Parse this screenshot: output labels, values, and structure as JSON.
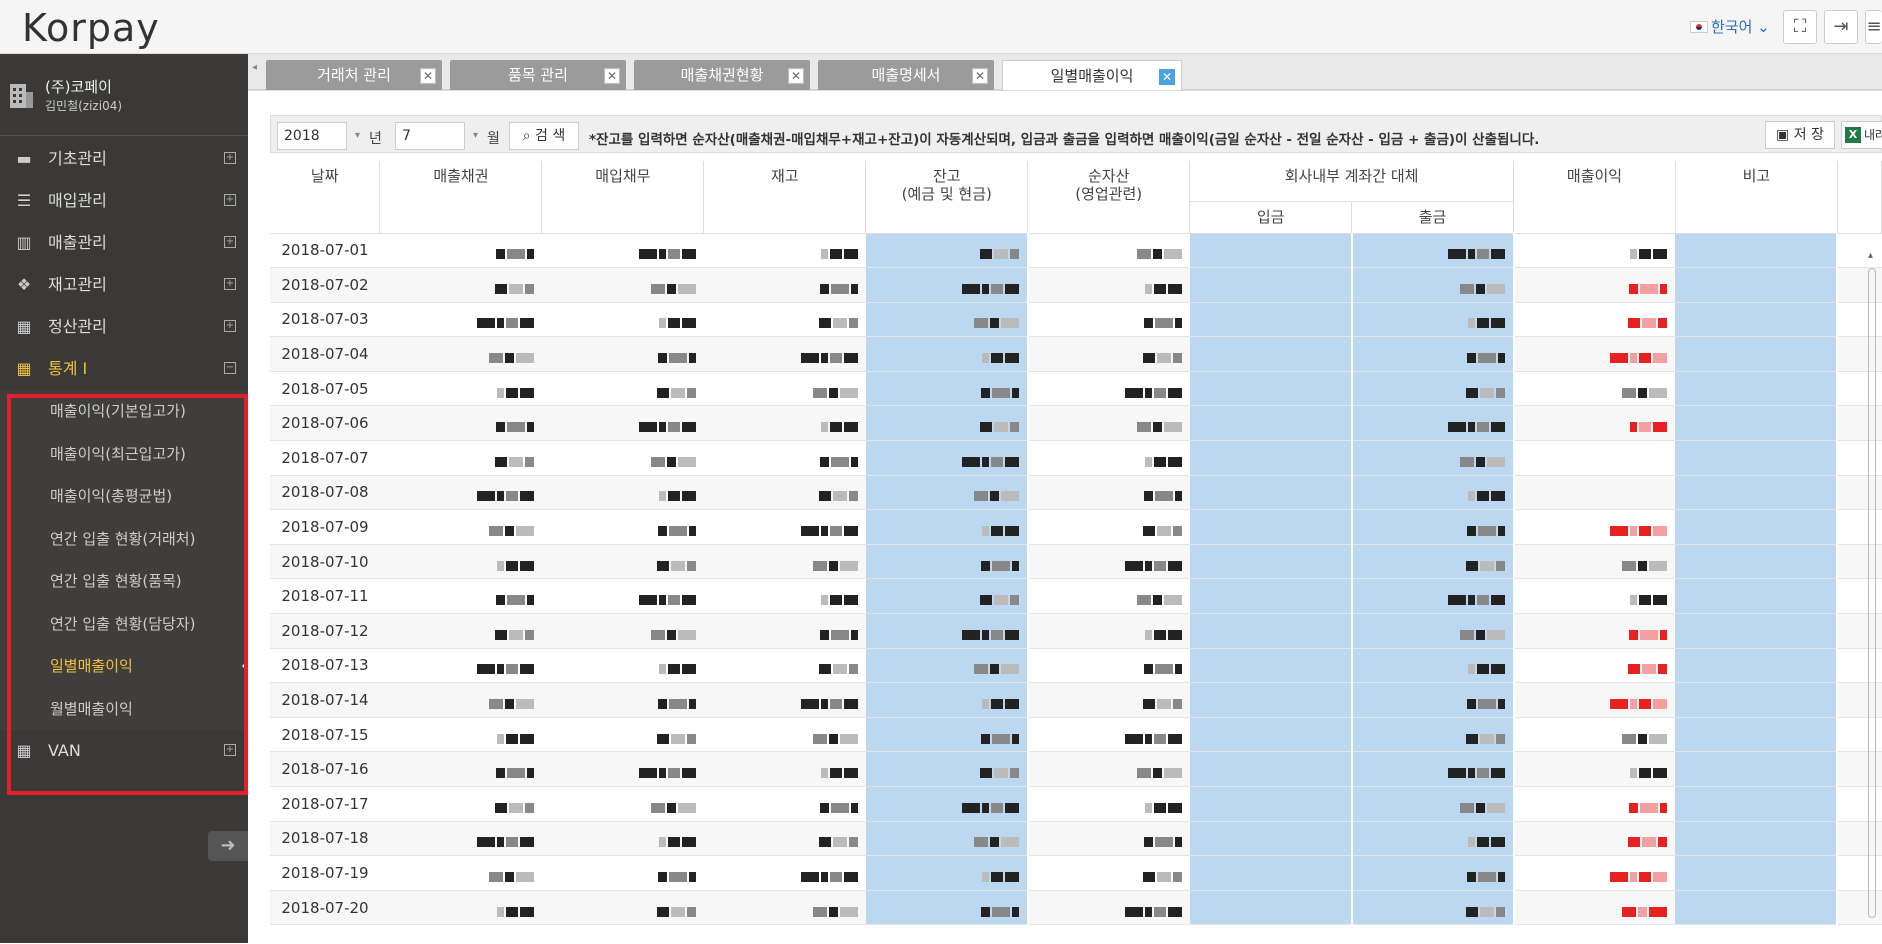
{
  "app": {
    "logo": "Korpay",
    "language": "한국어",
    "header_buttons": [
      "fullscreen-icon",
      "logout-icon",
      "menu-icon"
    ]
  },
  "sidebar": {
    "company_name": "(주)코페이",
    "user": "김민철(zizi04)",
    "menu": [
      {
        "label": "기초관리",
        "icon": "folder-icon"
      },
      {
        "label": "매입관리",
        "icon": "list-icon"
      },
      {
        "label": "매출관리",
        "icon": "bar-chart-icon"
      },
      {
        "label": "재고관리",
        "icon": "boxes-icon"
      },
      {
        "label": "정산관리",
        "icon": "calculator-icon"
      },
      {
        "label": "통계 I",
        "icon": "calculator-icon",
        "expanded": true
      },
      {
        "label": "VAN",
        "icon": "calculator-icon"
      }
    ],
    "submenu": [
      "매출이익(기본입고가)",
      "매출이익(최근입고가)",
      "매출이익(총평균법)",
      "연간 입출 현황(거래처)",
      "연간 입출 현황(품목)",
      "연간 입출 현황(담당자)",
      "일별매출이익",
      "월별매출이익"
    ],
    "selected_sub": "일별매출이익"
  },
  "tabs": [
    {
      "label": "거래처 관리"
    },
    {
      "label": "품목 관리"
    },
    {
      "label": "매출채권현황"
    },
    {
      "label": "매출명세서"
    },
    {
      "label": "일별매출이익",
      "active": true
    }
  ],
  "toolbar": {
    "year": "2018",
    "year_label": "년",
    "month": "7",
    "month_label": "월",
    "search_label": "검 색",
    "notice": "*잔고를 입력하면 순자산(매출채권-매입채무+재고+잔고)이 자동계산되며, 입금과 출금을 입력하면 매출이익(금일 순자산 - 전일 순자산 - 입금 + 출금)이 산출됩니다.",
    "save_label": "저 장",
    "export_label": "내려받기"
  },
  "table": {
    "headers": {
      "date": "날짜",
      "receivable": "매출채권",
      "payable": "매입채무",
      "inventory": "재고",
      "balance": "잔고",
      "balance_sub": "(예금 및 현금)",
      "net_assets": "순자산",
      "net_assets_sub": "(영업관련)",
      "internal_transfer": "회사내부 계좌간 대체",
      "deposit": "입금",
      "withdrawal": "출금",
      "profit": "매출이익",
      "note": "비고"
    },
    "dates": [
      "2018-07-01",
      "2018-07-02",
      "2018-07-03",
      "2018-07-04",
      "2018-07-05",
      "2018-07-06",
      "2018-07-07",
      "2018-07-08",
      "2018-07-09",
      "2018-07-10",
      "2018-07-11",
      "2018-07-12",
      "2018-07-13",
      "2018-07-14",
      "2018-07-15",
      "2018-07-16",
      "2018-07-17",
      "2018-07-18",
      "2018-07-19",
      "2018-07-20"
    ]
  },
  "colors": {
    "sidebar_bg": "#3a3937",
    "active_yellow": "#f0c040",
    "highlight_red": "#e0202a",
    "editable_blue": "#bcd7f0",
    "profit_red": "#e82020"
  }
}
